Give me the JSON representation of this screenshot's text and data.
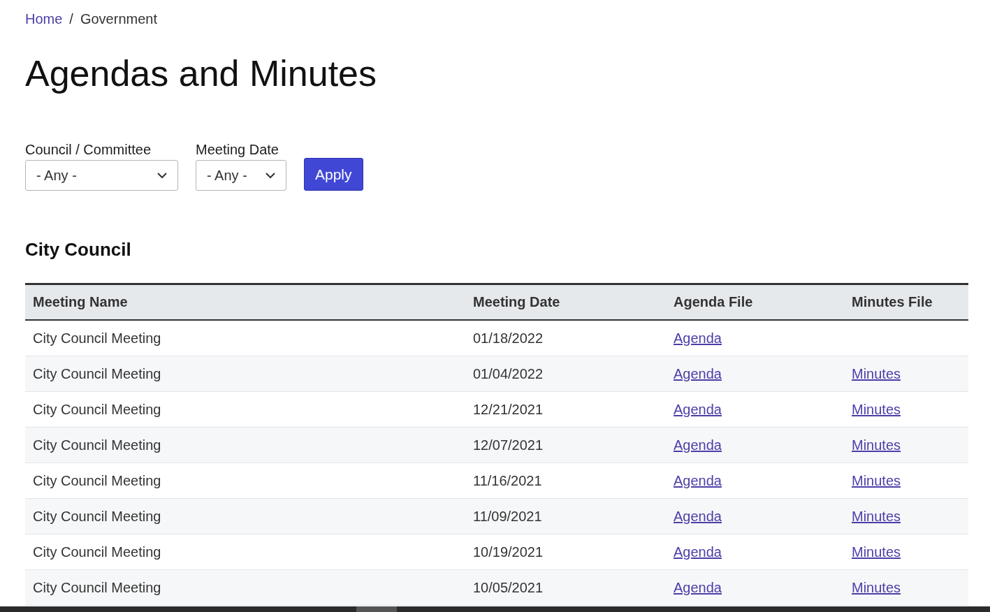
{
  "breadcrumb": {
    "items": [
      {
        "label": "Home",
        "kind": "link"
      },
      {
        "label": "Government",
        "kind": "current"
      }
    ],
    "separator": "/"
  },
  "title": "Agendas and Minutes",
  "filters": [
    {
      "label": "Council / Committee",
      "value": "- Any -"
    },
    {
      "label": "Meeting Date",
      "value": "- Any -"
    }
  ],
  "apply_button": "Apply",
  "section": {
    "heading": "City Council",
    "table": {
      "columns": [
        "Meeting Name",
        "Meeting Date",
        "Agenda File",
        "Minutes File"
      ],
      "rows": [
        {
          "meeting_name": "City Council Meeting",
          "meeting_date": "01/18/2022",
          "agenda_file": "Agenda"
        },
        {
          "meeting_name": "City Council Meeting",
          "meeting_date": "01/04/2022",
          "agenda_file": "Agenda",
          "minutes_file": "Minutes"
        },
        {
          "meeting_name": "City Council Meeting",
          "meeting_date": "12/21/2021",
          "agenda_file": "Agenda",
          "minutes_file": "Minutes"
        },
        {
          "meeting_name": "City Council Meeting",
          "meeting_date": "12/07/2021",
          "agenda_file": "Agenda",
          "minutes_file": "Minutes"
        },
        {
          "meeting_name": "City Council Meeting",
          "meeting_date": "11/16/2021",
          "agenda_file": "Agenda",
          "minutes_file": "Minutes"
        },
        {
          "meeting_name": "City Council Meeting",
          "meeting_date": "11/09/2021",
          "agenda_file": "Agenda",
          "minutes_file": "Minutes"
        },
        {
          "meeting_name": "City Council Meeting",
          "meeting_date": "10/19/2021",
          "agenda_file": "Agenda",
          "minutes_file": "Minutes"
        },
        {
          "meeting_name": "City Council Meeting",
          "meeting_date": "10/05/2021",
          "agenda_file": "Agenda",
          "minutes_file": "Minutes"
        }
      ]
    }
  }
}
